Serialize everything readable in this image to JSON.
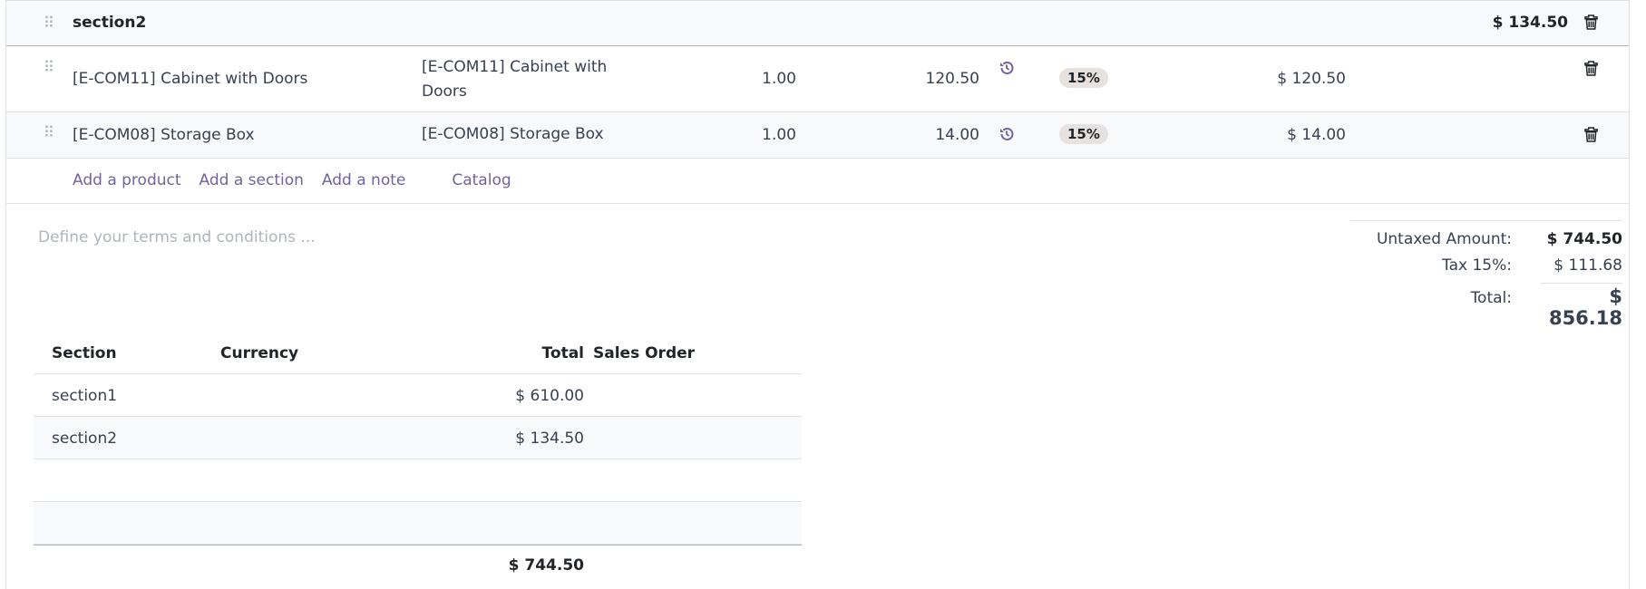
{
  "section_line": {
    "name": "section2",
    "total": "$ 134.50"
  },
  "order_lines": [
    {
      "product": "[E-COM11] Cabinet with Doors",
      "description": "[E-COM11] Cabinet with Doors",
      "quantity": "1.00",
      "unit_price": "120.50",
      "tax": "15%",
      "subtotal": "$ 120.50"
    },
    {
      "product": "[E-COM08] Storage Box",
      "description": "[E-COM08] Storage Box",
      "quantity": "1.00",
      "unit_price": "14.00",
      "tax": "15%",
      "subtotal": "$ 14.00"
    }
  ],
  "add_links": {
    "product": "Add a product",
    "section": "Add a section",
    "note": "Add a note",
    "catalog": "Catalog"
  },
  "terms_placeholder": "Define your terms and conditions ...",
  "totals": {
    "untaxed_label": "Untaxed Amount:",
    "untaxed_value": "$ 744.50",
    "tax_label": "Tax 15%:",
    "tax_value": "$ 111.68",
    "total_label": "Total:",
    "total_value": "$ 856.18"
  },
  "section_table": {
    "headers": {
      "section": "Section",
      "currency": "Currency",
      "total": "Total",
      "sales_order": "Sales Order"
    },
    "rows": [
      {
        "section": "section1",
        "total": "$ 610.00"
      },
      {
        "section": "section2",
        "total": "$ 134.50"
      }
    ],
    "footer_total": "$ 744.50"
  },
  "colors": {
    "link": "#71639e",
    "border": "#dee2e6",
    "tax_badge": "#e7e1df"
  }
}
